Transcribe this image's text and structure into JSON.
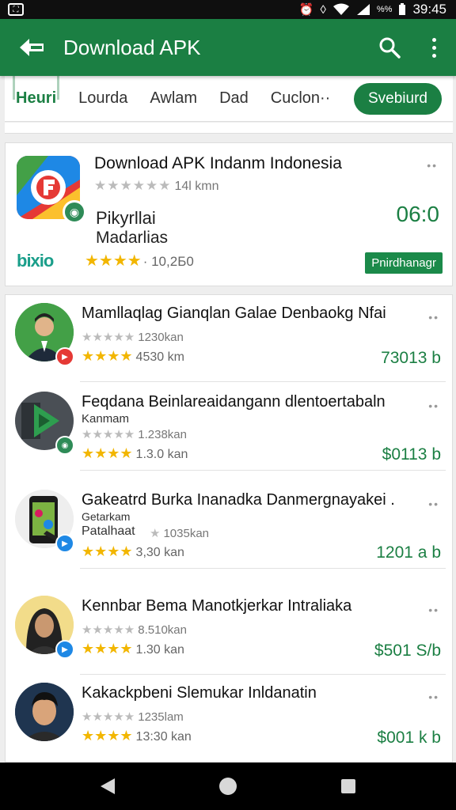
{
  "status_bar": {
    "time": "39:45",
    "battery_text": "%%"
  },
  "appbar": {
    "title": "Download APK"
  },
  "tabs": [
    {
      "label": "Heuri",
      "active": true
    },
    {
      "label": "Lourda",
      "active": false
    },
    {
      "label": "Awlam",
      "active": false
    },
    {
      "label": "Dad",
      "active": false
    },
    {
      "label": "Cuclon··",
      "active": false
    }
  ],
  "tab_button": "Svebiurd",
  "featured": {
    "title": "Download APK Indanm Indonesia",
    "grey_rating": "14l kmn",
    "line1": "Pikyrllai",
    "line2": "Madarlias",
    "brand": "bixio",
    "gold_rating": "· 10,2Б0",
    "price": "06:0",
    "install_label": "Pnirdhanagr"
  },
  "list": [
    {
      "title": "Mamllaqlag Gianqlan Galae Denbaokg Nfai",
      "subtitle": "",
      "grey_rating": "1230kan",
      "gold_rating": "4530 km",
      "price": "73013 b",
      "badge_color": "#e53935"
    },
    {
      "title": "Feqdana Beinlareaidangann dlentoertabaln",
      "subtitle": "Kanmam",
      "grey_rating": "1.238kan",
      "gold_rating": "1.3.0 kan",
      "price": "$0113 b",
      "badge_color": "#2e8b57"
    },
    {
      "title": "Gakeatrd Burka Inanadka Danmergnayakei .",
      "subtitle": "Getarkam",
      "subtitle2": "Patalhaat",
      "grey_rating": "1035kan",
      "gold_rating": "3,30 kan",
      "price": "1201 a b",
      "badge_color": "#1e88e5"
    },
    {
      "title": "Kennbar Bema Manotkjerkar Intraliaka",
      "subtitle": "",
      "grey_rating": "8.510kan",
      "gold_rating": "1.30 kan",
      "price": "$501 S/b",
      "badge_color": "#1e88e5"
    },
    {
      "title": "Kakackpbeni Slemukar Inldanatin",
      "subtitle": "",
      "grey_rating": "1235lam",
      "gold_rating": "13:30 kan",
      "price": "$001 k b",
      "badge_color": ""
    }
  ],
  "icons": [
    "back-icon",
    "search-icon",
    "more-vert-icon",
    "nav-back-icon",
    "nav-home-icon",
    "nav-recents-icon"
  ]
}
